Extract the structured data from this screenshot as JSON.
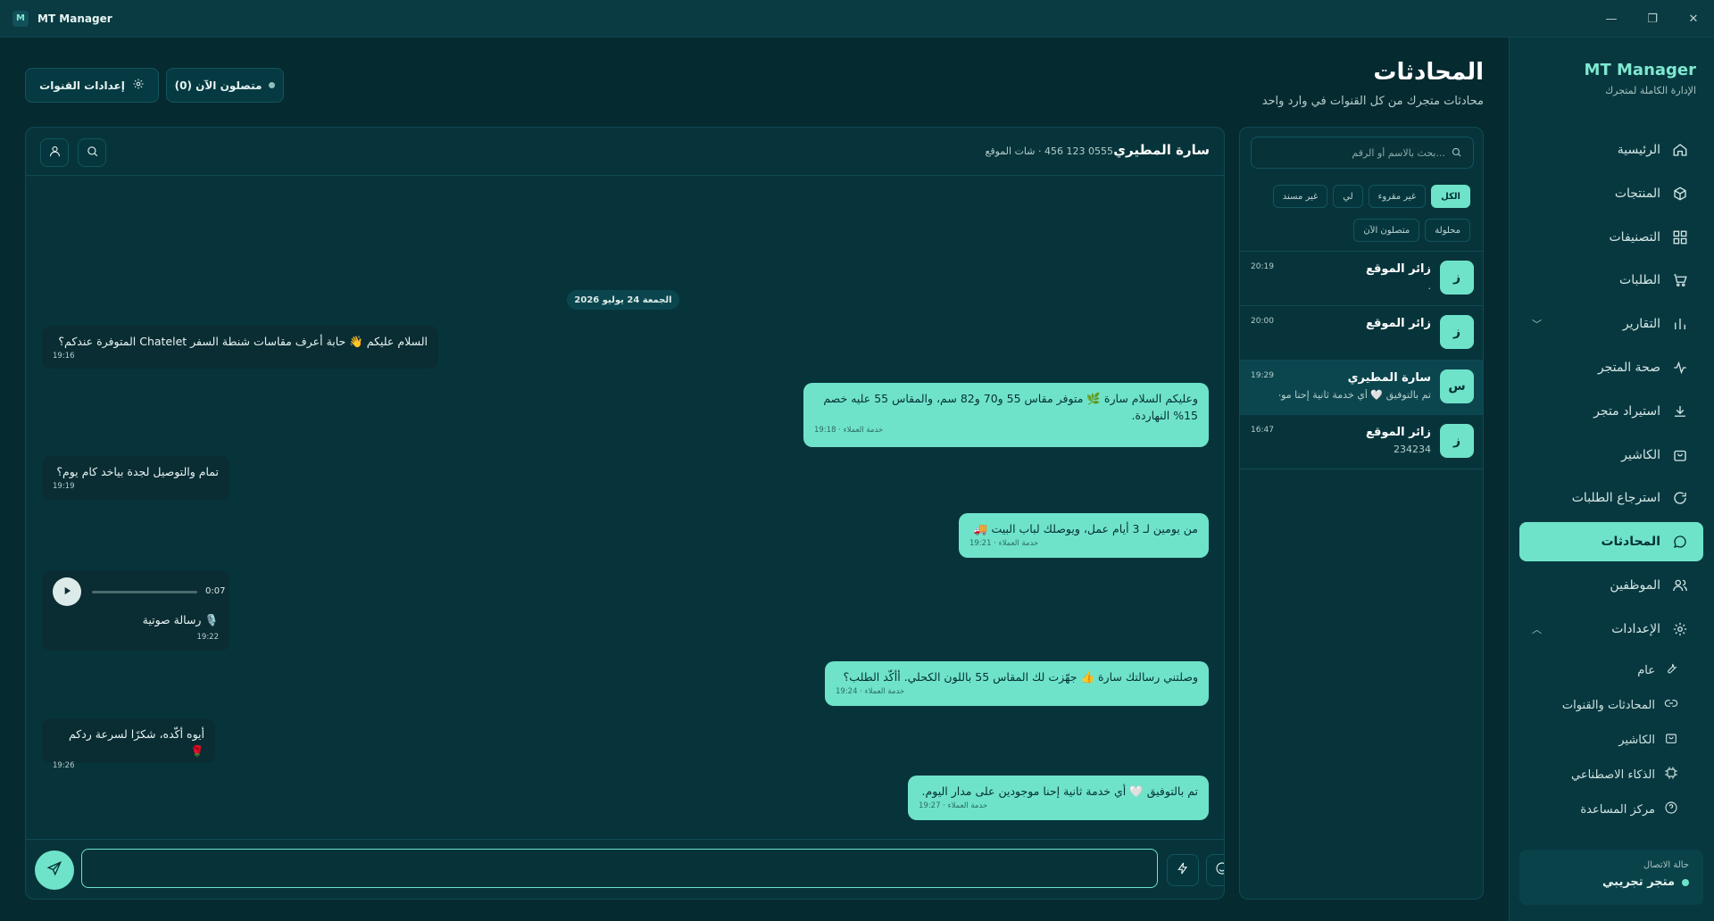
{
  "window": {
    "title": "MT Manager",
    "logo_letter": "M",
    "controls": [
      "—",
      "❐",
      "✕"
    ]
  },
  "sidebar": {
    "brand": "MT Manager",
    "tagline": "الإدارة الكاملة لمتجرك",
    "items": [
      {
        "label": "الرئيسية",
        "icon": "home-icon"
      },
      {
        "label": "المنتجات",
        "icon": "box-icon"
      },
      {
        "label": "التصنيفات",
        "icon": "grid-icon"
      },
      {
        "label": "الطلبات",
        "icon": "cart-icon"
      },
      {
        "label": "التقارير",
        "icon": "bar-chart-icon"
      },
      {
        "label": "صحة المتجر",
        "icon": "pulse-icon"
      },
      {
        "label": "استيراد متجر",
        "icon": "download-icon"
      },
      {
        "label": "الكاشير",
        "icon": "bag-icon"
      },
      {
        "label": "استرجاع الطلبات",
        "icon": "refresh-icon"
      },
      {
        "label": "المحادثات",
        "icon": "chat-icon"
      },
      {
        "label": "الموظفين",
        "icon": "users-icon"
      },
      {
        "label": "الإعدادات",
        "icon": "gear-icon"
      }
    ],
    "settings_sub": [
      {
        "label": "عام",
        "icon": "wrench-icon"
      },
      {
        "label": "المحادثات والقنوات",
        "icon": "link-icon"
      },
      {
        "label": "الكاشير",
        "icon": "bag-icon"
      },
      {
        "label": "الذكاء الاصطناعي",
        "icon": "chip-icon"
      },
      {
        "label": "مركز المساعدة",
        "icon": "help-icon"
      }
    ],
    "connection": {
      "label": "حالة الاتصال",
      "store": "متجر تجريبي"
    }
  },
  "header": {
    "title": "المحادثات",
    "subtitle": "محادثات متجرك من كل القنوات في وارد واحد",
    "online_button": "متصلون الآن (0)",
    "channels_button": "إعدادات القنوات"
  },
  "list": {
    "search_placeholder": "بحث بالاسم أو الرقم...",
    "filters_row1": [
      "الكل",
      "غير مقروء",
      "لي",
      "غير مسند"
    ],
    "filters_row2": [
      "محلولة",
      "متصلون الآن"
    ],
    "conversations": [
      {
        "initial": "ز",
        "name": "زائر الموقع",
        "preview": ".",
        "time": "20:19"
      },
      {
        "initial": "ز",
        "name": "زائر الموقع",
        "preview": "",
        "time": "20:00"
      },
      {
        "initial": "س",
        "name": "سارة المطيري",
        "preview": "تم بالتوفيق 🤍 أي خدمة ثانية إحنا موجو...",
        "time": "19:29"
      },
      {
        "initial": "ز",
        "name": "زائر الموقع",
        "preview": "234234",
        "time": "16:47"
      }
    ]
  },
  "chat": {
    "contact_name": "سارة المطيري",
    "contact_meta": "0555 123 456 · شات الموقع",
    "date_divider": "الجمعة 24 يوليو 2026",
    "messages": [
      {
        "dir": "in",
        "text": "السلام عليكم 👋 حابة أعرف مقاسات شنطة السفر Chatelet المتوفرة عندكم؟",
        "meta": "19:16"
      },
      {
        "dir": "out",
        "text": "وعليكم السلام سارة 🌿 متوفر مقاس 55 و70 و82 سم، والمقاس 55 عليه خصم 15% النهاردة.",
        "meta": "خدمة العملاء · 19:18"
      },
      {
        "dir": "in",
        "text": "تمام والتوصيل لجدة بياخد كام يوم؟",
        "meta": "19:19"
      },
      {
        "dir": "out",
        "text": "من يومين لـ 3 أيام عمل، ويوصلك لباب البيت 🚚",
        "meta": "خدمة العملاء · 19:21"
      },
      {
        "dir": "in",
        "voice": true,
        "duration": "0:07",
        "text": "🎙️ رسالة صوتية",
        "meta": "19:22"
      },
      {
        "dir": "out",
        "text": "وصلتني رسالتك سارة 👍 جهّزت لك المقاس 55 باللون الكحلي. أأكّد الطلب؟",
        "meta": "خدمة العملاء · 19:24"
      },
      {
        "dir": "in",
        "text": "أيوه أكّده، شكرًا لسرعة ردكم 🌹",
        "meta": "19:26"
      },
      {
        "dir": "out",
        "text": "تم بالتوفيق 🤍 أي خدمة ثانية إحنا موجودين على مدار اليوم.",
        "meta": "خدمة العملاء · 19:27"
      }
    ],
    "composer_value": ""
  }
}
